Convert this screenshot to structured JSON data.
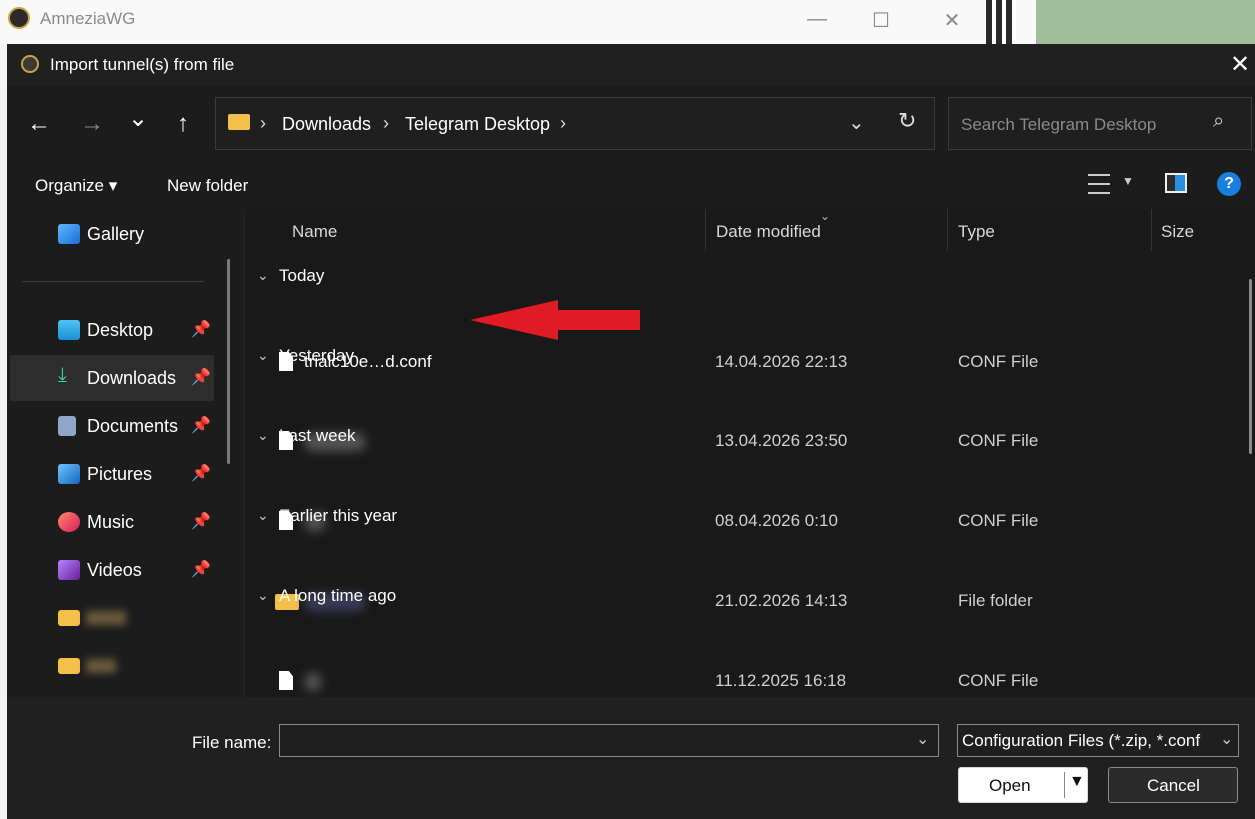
{
  "background_app": {
    "title": "AmneziaWG",
    "minimize": "—",
    "maximize": "☐",
    "close": "✕"
  },
  "dialog": {
    "title": "Import tunnel(s) from file",
    "close": "✕",
    "nav": {
      "back": "←",
      "forward": "→",
      "recent": "⌄",
      "up": "↑"
    },
    "address": {
      "crumbs": [
        "Downloads",
        "Telegram Desktop"
      ],
      "separator": "›",
      "dropdown": "⌄",
      "refresh": "↻"
    },
    "search": {
      "placeholder": "Search Telegram Desktop",
      "icon": "⌕"
    },
    "commands": {
      "organize": "Organize ▾",
      "new_folder": "New folder",
      "help": "?"
    },
    "sidebar": {
      "items": [
        {
          "label": "Gallery",
          "icon": "gallery-icon"
        },
        {
          "label": "Desktop",
          "icon": "desktop-icon",
          "pinned": true
        },
        {
          "label": "Downloads",
          "icon": "downloads-icon",
          "pinned": true,
          "selected": true
        },
        {
          "label": "Documents",
          "icon": "documents-icon",
          "pinned": true
        },
        {
          "label": "Pictures",
          "icon": "pictures-icon",
          "pinned": true
        },
        {
          "label": "Music",
          "icon": "music-icon",
          "pinned": true
        },
        {
          "label": "Videos",
          "icon": "videos-icon",
          "pinned": true
        }
      ],
      "pin_glyph": "📌"
    },
    "columns": [
      "Name",
      "Date modified",
      "Type",
      "Size"
    ],
    "groups": [
      {
        "label": "Today",
        "rows": [
          {
            "name": "trialc10e…d.conf",
            "date": "14.04.2026 22:13",
            "type": "CONF File",
            "kind": "file"
          }
        ]
      },
      {
        "label": "Yesterday",
        "rows": [
          {
            "name": "",
            "date": "13.04.2026 23:50",
            "type": "CONF File",
            "kind": "file"
          }
        ]
      },
      {
        "label": "Last week",
        "rows": [
          {
            "name": "",
            "date": "08.04.2026 0:10",
            "type": "CONF File",
            "kind": "file"
          }
        ]
      },
      {
        "label": "Earlier this year",
        "rows": [
          {
            "name": "",
            "date": "21.02.2026 14:13",
            "type": "File folder",
            "kind": "folder"
          }
        ]
      },
      {
        "label": "A long time ago",
        "rows": [
          {
            "name": "",
            "date": "11.12.2025 16:18",
            "type": "CONF File",
            "kind": "file"
          }
        ]
      }
    ],
    "chevron": "⌄",
    "footer": {
      "file_name_label": "File name:",
      "file_name_value": "",
      "filter": "Configuration Files (*.zip, *.conf",
      "open": "Open",
      "cancel": "Cancel",
      "dropdown": "⌄"
    }
  },
  "colors": {
    "dialog_bg": "#202020",
    "accent": "#1a7fe0",
    "folder": "#f3c14a",
    "annotation_arrow": "#e01b24"
  }
}
